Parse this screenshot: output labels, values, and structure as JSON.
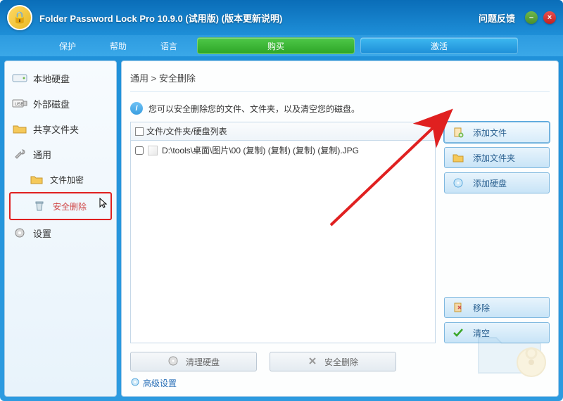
{
  "title": "Folder Password Lock Pro 10.9.0 (试用版) (版本更新说明)",
  "feedback": "问题反馈",
  "menu": {
    "protect": "保护",
    "help": "帮助",
    "language": "语言"
  },
  "bigbuttons": {
    "buy": "购买",
    "activate": "激活"
  },
  "sidebar": {
    "items": [
      {
        "label": "本地硬盘"
      },
      {
        "label": "外部磁盘"
      },
      {
        "label": "共享文件夹"
      },
      {
        "label": "通用"
      },
      {
        "label": "文件加密"
      },
      {
        "label": "安全删除"
      },
      {
        "label": "设置"
      }
    ]
  },
  "breadcrumb": "通用 > 安全删除",
  "info": "您可以安全删除您的文件、文件夹，以及清空您的磁盘。",
  "list": {
    "header": "文件/文件夹/硬盘列表",
    "rows": [
      {
        "path": "D:\\tools\\桌面\\图片\\00 (复制) (复制) (复制) (复制).JPG"
      }
    ]
  },
  "actions": {
    "addFile": "添加文件",
    "addFolder": "添加文件夹",
    "addDisk": "添加硬盘",
    "remove": "移除",
    "clear": "清空"
  },
  "bottom": {
    "cleanDisk": "清理硬盘",
    "secureDelete": "安全删除",
    "advanced": "高级设置"
  }
}
